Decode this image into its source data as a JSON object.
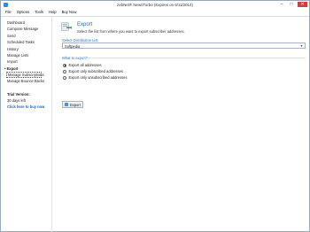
{
  "window": {
    "title": "zebNet® NewsTurbo (Expires on 6/11/2014)",
    "controls": {
      "minimize": "–",
      "maximize": "□",
      "close": "✕"
    }
  },
  "menu": [
    "File",
    "Options",
    "Tools",
    "Help",
    "Buy Now"
  ],
  "sidebar": {
    "items": [
      "Dashboard",
      "Compose Message",
      "Send",
      "Scheduled Tasks",
      "History",
      "Manage Lists",
      "Import",
      "Export",
      "Manage Subscriptions",
      "Manage Bounce Backs"
    ],
    "trial": {
      "heading": "Trial Version:",
      "days_left": "30 days left",
      "buy_link": "Click here to buy now"
    }
  },
  "main": {
    "title": "Export",
    "subtitle": "Select the list from where you want to export subscriber addresses.",
    "list_label": "Select Distribution List",
    "list_value": "Softpedia",
    "group_label": "What to export?",
    "options": [
      "Export all addresses",
      "Export only subscribed addresses",
      "Export only unsubscribed addresses"
    ],
    "selected_option_index": 0,
    "export_button": "Export"
  },
  "colors": {
    "accent": "#2e6fb8",
    "link": "#2b62b6",
    "close_button": "#c7433b"
  }
}
